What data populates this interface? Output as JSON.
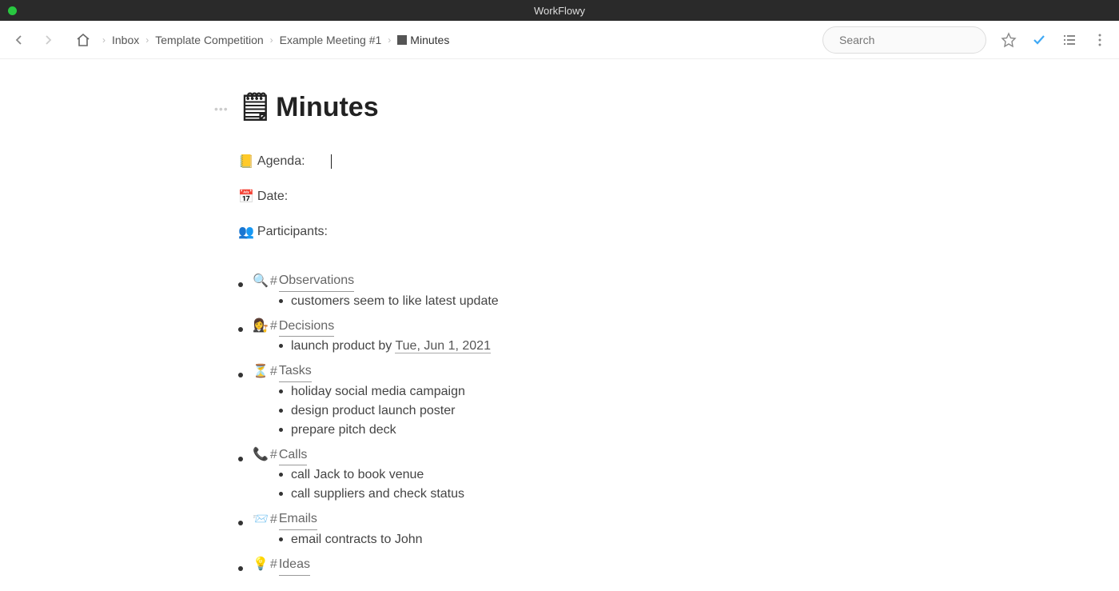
{
  "app": {
    "title": "WorkFlowy"
  },
  "breadcrumb": {
    "items": [
      {
        "label": "Inbox"
      },
      {
        "label": "Template Competition"
      },
      {
        "label": "Example Meeting #1"
      },
      {
        "label": "Minutes",
        "icon": "🗒"
      }
    ]
  },
  "search": {
    "placeholder": "Search"
  },
  "page": {
    "title_icon": "🗒",
    "title": "Minutes"
  },
  "fields": {
    "agenda": {
      "icon": "📒",
      "label": "Agenda:"
    },
    "date": {
      "icon": "📅",
      "label": "Date:"
    },
    "participants": {
      "icon": "👥",
      "label": "Participants:"
    }
  },
  "sections": [
    {
      "icon": "🔍",
      "tag": "Observations",
      "items": [
        "customers seem to like latest update"
      ]
    },
    {
      "icon": "👩‍⚖️",
      "tag": "Decisions",
      "items": [
        "launch product by Tue, Jun 1, 2021"
      ],
      "date_highlight": "Tue, Jun 1, 2021"
    },
    {
      "icon": "⏳",
      "tag": "Tasks",
      "items": [
        "holiday social media campaign",
        "design product launch poster",
        "prepare pitch deck"
      ]
    },
    {
      "icon": "📞",
      "tag": "Calls",
      "items": [
        "call Jack to book venue",
        "call suppliers and check status"
      ]
    },
    {
      "icon": "📨",
      "tag": "Emails",
      "items": [
        "email contracts to John"
      ]
    },
    {
      "icon": "💡",
      "tag": "Ideas",
      "items": []
    }
  ]
}
